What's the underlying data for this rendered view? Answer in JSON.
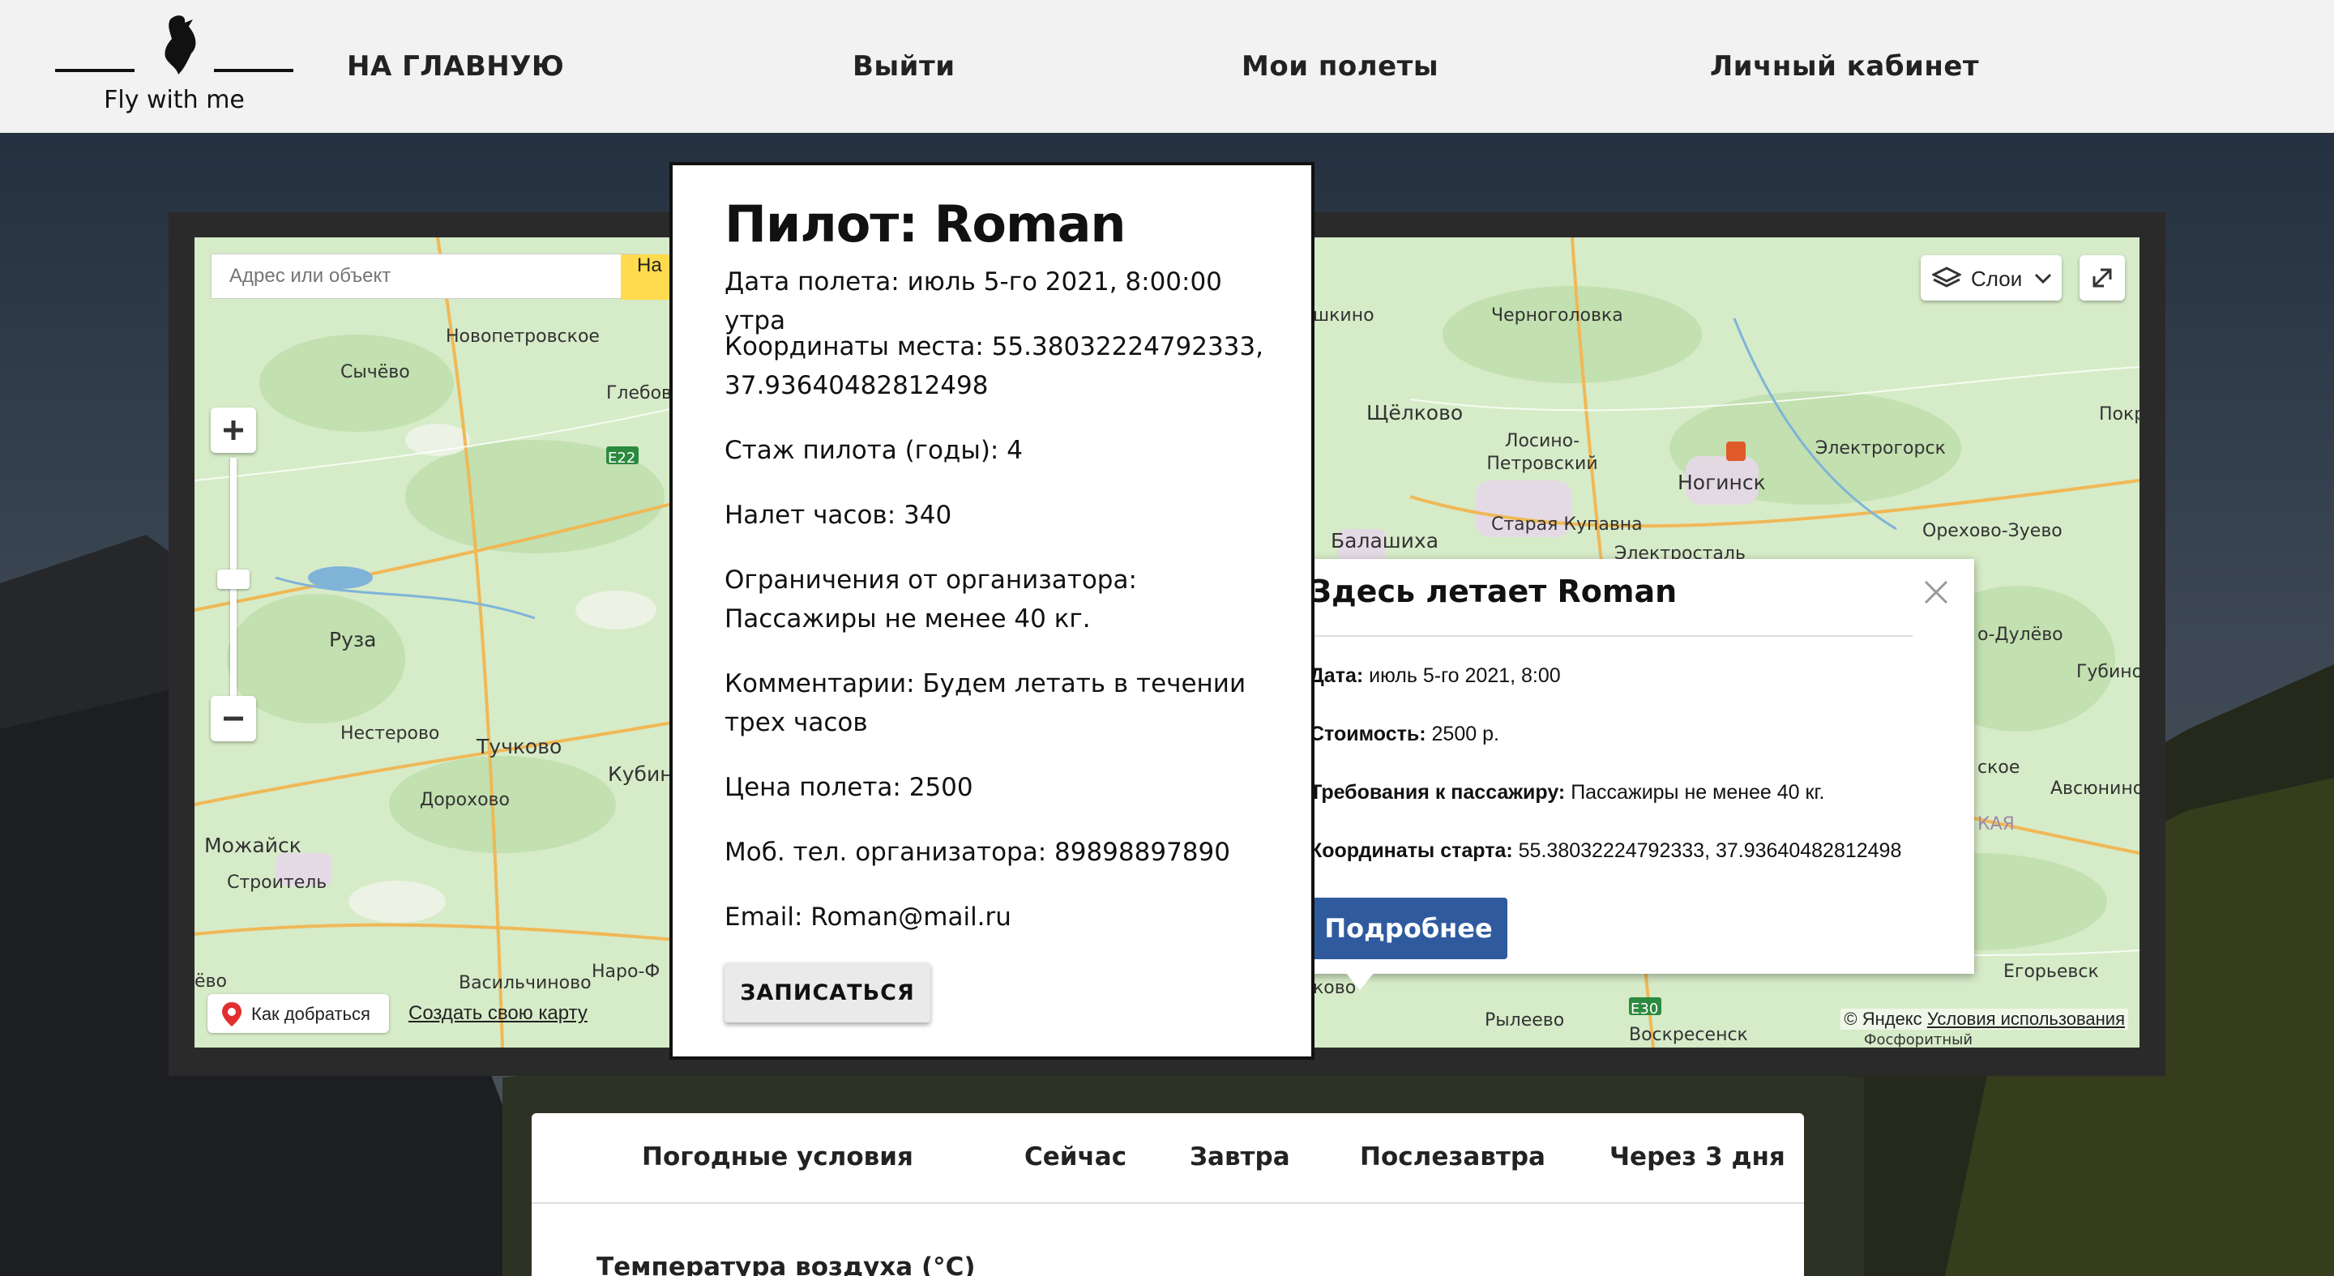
{
  "header": {
    "logo_text": "Fly with me",
    "nav": {
      "home": "НА ГЛАВНУЮ",
      "logout": "Выйти",
      "my_flights": "Мои полеты",
      "cabinet": "Личный кабинет"
    }
  },
  "map": {
    "search_placeholder": "Адрес или объект",
    "search_button": "На",
    "layers_label": "Слои",
    "route_label": "Как добраться",
    "create_map_label": "Создать свою карту",
    "copyright_owner": "© Яндекс",
    "terms_link": "Условия использования",
    "road_labels": [
      "E22",
      "E30"
    ],
    "cities": [
      "Новопетровское",
      "Сычёво",
      "Глебов",
      "Руза",
      "Нестерово",
      "Тучково",
      "Кубин",
      "Дорохово",
      "Можайск",
      "Строитель",
      "Васильчиново",
      "Наро-Ф",
      "ёво",
      "шкино",
      "Черноголовка",
      "Щёлково",
      "Лосино-Петровский",
      "Ногинск",
      "Электрогорск",
      "Покро",
      "Балашиха",
      "Старая Купавна",
      "Электросталь",
      "Орехово-Зуево",
      "о-Дулёво",
      "Губино",
      "ское",
      "Авсюнино",
      "КАЯ",
      "Егорьевск",
      "ково",
      "Рылеево",
      "Воскресенск",
      "Фосфоритный"
    ]
  },
  "balloon": {
    "title": "Здесь летает Roman",
    "date_label": "Дата:",
    "date_value": "июль 5-го 2021, 8:00",
    "price_label": "Стоимость:",
    "price_value": "2500 р.",
    "req_label": "Требования к пассажиру:",
    "req_value": "Пассажиры не менее 40 кг.",
    "coords_label": "Координаты старта:",
    "coords_value": "55.38032224792333, 37.93640482812498",
    "more_button": "Подробнее"
  },
  "modal": {
    "title": "Пилот: Roman",
    "lines": [
      "Дата полета: июль 5-го 2021, 8:00:00 утра",
      "Координаты места: 55.38032224792333, 37.93640482812498",
      "Стаж пилота (годы): 4",
      "Налет часов: 340",
      "Ограничения от организатора: Пассажиры не менее 40 кг.",
      "Комментарии: Будем летать в течении трех часов",
      "Цена полета: 2500",
      "Моб. тел. организатора: 89898897890",
      "Email: Roman@mail.ru"
    ],
    "enroll_button": "ЗАПИСАТЬСЯ"
  },
  "weather": {
    "tabs": [
      "Погодные условия",
      "Сейчас",
      "Завтра",
      "Послезавтра",
      "Через 3 дня"
    ],
    "row_label": "Температура воздуха (°C)"
  },
  "colors": {
    "header_bg": "#f2f2f2",
    "map_bg": "#cfe6c3",
    "search_button": "#ffdb4d",
    "more_button": "#2f5b9e"
  }
}
